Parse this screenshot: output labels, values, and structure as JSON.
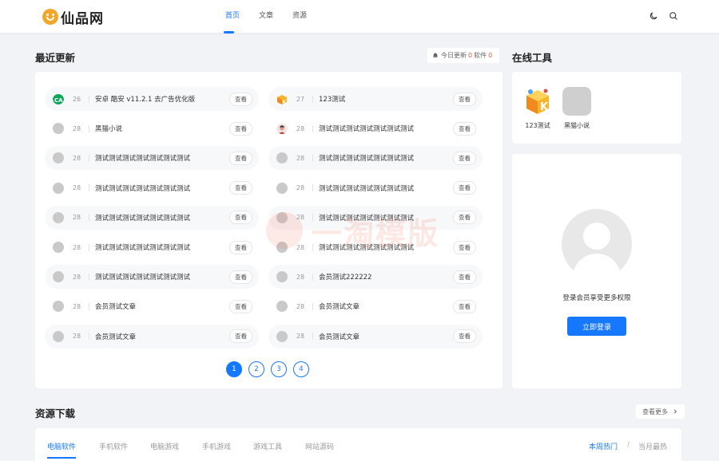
{
  "header": {
    "logo_text": "仙品网",
    "nav": [
      {
        "label": "首页",
        "active": true
      },
      {
        "label": "文章",
        "active": false
      },
      {
        "label": "资源",
        "active": false
      }
    ]
  },
  "recent": {
    "title": "最近更新",
    "today_prefix": "今日更新",
    "today_count": "0",
    "software_label": "软件",
    "software_count": "0",
    "view_label": "查看",
    "items": [
      {
        "count": "26",
        "title": "安卓 酷安 v11.2.1 去广告优化版",
        "icon": "coolapk-icon"
      },
      {
        "count": "27",
        "title": "123测试",
        "icon": "cube-app-icon"
      },
      {
        "count": "28",
        "title": "黑猫小说",
        "icon": "default-avatar-icon"
      },
      {
        "count": "28",
        "title": "测试测试测试测试测试测试测试",
        "icon": "user-photo-icon"
      },
      {
        "count": "28",
        "title": "测试测试测试测试测试测试测试",
        "icon": "default-avatar-icon"
      },
      {
        "count": "28",
        "title": "测试测试测试测试测试测试测试",
        "icon": "default-avatar-icon"
      },
      {
        "count": "28",
        "title": "测试测试测试测试测试测试测试",
        "icon": "default-avatar-icon"
      },
      {
        "count": "28",
        "title": "测试测试测试测试测试测试测试",
        "icon": "default-avatar-icon"
      },
      {
        "count": "28",
        "title": "测试测试测试测试测试测试测试",
        "icon": "default-avatar-icon"
      },
      {
        "count": "28",
        "title": "测试测试测试测试测试测试测试",
        "icon": "default-avatar-icon"
      },
      {
        "count": "28",
        "title": "测试测试测试测试测试测试测试",
        "icon": "default-avatar-icon"
      },
      {
        "count": "28",
        "title": "测试测试测试测试测试测试测试",
        "icon": "default-avatar-icon"
      },
      {
        "count": "28",
        "title": "测试测试测试测试测试测试测试",
        "icon": "default-avatar-icon"
      },
      {
        "count": "28",
        "title": "会员测试222222",
        "icon": "default-avatar-icon"
      },
      {
        "count": "28",
        "title": "会员测试文章",
        "icon": "default-avatar-icon"
      },
      {
        "count": "28",
        "title": "会员测试文章",
        "icon": "default-avatar-icon"
      },
      {
        "count": "28",
        "title": "会员测试文章",
        "icon": "default-avatar-icon"
      },
      {
        "count": "28",
        "title": "会员测试文章",
        "icon": "default-avatar-icon"
      }
    ],
    "pages": [
      "1",
      "2",
      "3",
      "4"
    ],
    "current_page": "1"
  },
  "tools": {
    "title": "在线工具",
    "items": [
      {
        "label": "123测试",
        "icon": "cube-app-icon"
      },
      {
        "label": "黑猫小说",
        "icon": "placeholder-app-icon"
      }
    ]
  },
  "login": {
    "tip": "登录会员享受更多权限",
    "button": "立即登录"
  },
  "downloads": {
    "title": "资源下载",
    "more": "查看更多",
    "tabs": [
      {
        "label": "电脑软件",
        "active": true
      },
      {
        "label": "手机软件",
        "active": false
      },
      {
        "label": "电脑游戏",
        "active": false
      },
      {
        "label": "手机游戏",
        "active": false
      },
      {
        "label": "游戏工具",
        "active": false
      },
      {
        "label": "网站源码",
        "active": false
      }
    ],
    "hot_week": "本周热门",
    "divider": "/",
    "hot_month": "当月最热"
  },
  "watermark": "一淘模版",
  "colors": {
    "accent": "#1677ff",
    "highlight": "#f35b3b",
    "page_bg": "#f1f3f7"
  }
}
